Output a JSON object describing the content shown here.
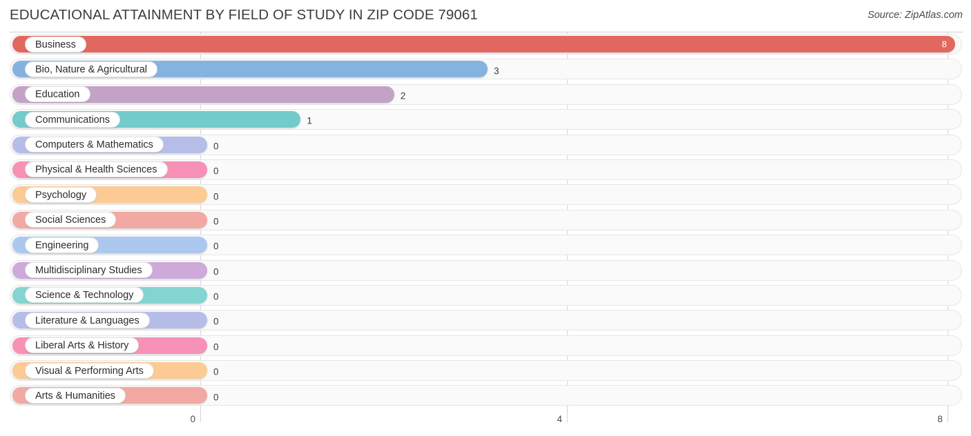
{
  "header": {
    "title": "EDUCATIONAL ATTAINMENT BY FIELD OF STUDY IN ZIP CODE 79061",
    "source": "Source: ZipAtlas.com"
  },
  "chart_data": {
    "type": "bar",
    "orientation": "horizontal",
    "title": "EDUCATIONAL ATTAINMENT BY FIELD OF STUDY IN ZIP CODE 79061",
    "subtitle": "",
    "xlabel": "",
    "ylabel": "",
    "xlim": [
      0,
      8
    ],
    "grid": true,
    "legend": "none",
    "xticks": [
      "0",
      "4",
      "8"
    ],
    "xtick_values": [
      0,
      4,
      8
    ],
    "categories": [
      "Business",
      "Bio, Nature & Agricultural",
      "Education",
      "Communications",
      "Computers & Mathematics",
      "Physical & Health Sciences",
      "Psychology",
      "Social Sciences",
      "Engineering",
      "Multidisciplinary Studies",
      "Science & Technology",
      "Literature & Languages",
      "Liberal Arts & History",
      "Visual & Performing Arts",
      "Arts & Humanities"
    ],
    "values": [
      8,
      3,
      2,
      1,
      0,
      0,
      0,
      0,
      0,
      0,
      0,
      0,
      0,
      0,
      0
    ],
    "value_labels": [
      "8",
      "3",
      "2",
      "1",
      "0",
      "0",
      "0",
      "0",
      "0",
      "0",
      "0",
      "0",
      "0",
      "0",
      "0"
    ],
    "colors": [
      "#e2685f",
      "#85b3e0",
      "#c4a2c8",
      "#73cbcb",
      "#b5bde8",
      "#f791b5",
      "#fbcb93",
      "#f2a9a3",
      "#adc8ef",
      "#cdaada",
      "#84d4d1",
      "#b5bde8",
      "#f791b5",
      "#fbcb93",
      "#f2a9a3"
    ]
  }
}
